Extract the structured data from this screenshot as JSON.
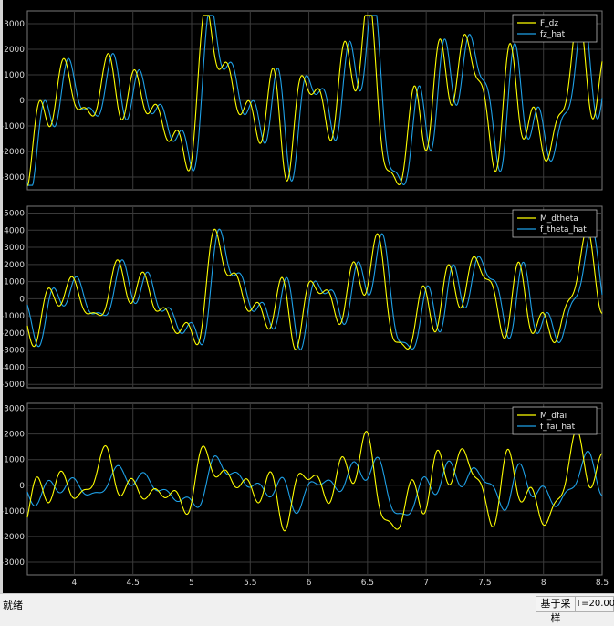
{
  "status": {
    "text": "就绪",
    "mode": "基于采样",
    "time": "T=20.000"
  },
  "colors": {
    "background": "#000000",
    "grid": "#3a3a3a",
    "tick_text": "#d8d8d8",
    "yellow": "#ffff00",
    "blue": "#1ea0e6"
  },
  "chart_data": [
    {
      "type": "line",
      "xlim": [
        3.6,
        8.5
      ],
      "ylim": [
        -3500,
        3500
      ],
      "yticks": [
        -3000,
        -2000,
        -1000,
        0,
        1000,
        2000,
        3000
      ],
      "ytick_labels": [
        "-3000",
        "-2000",
        "-1000",
        "0",
        "1000",
        "2000",
        "3000"
      ],
      "grid": true,
      "legend": "top-right",
      "series": [
        {
          "name": "F_dz",
          "color": "yellow",
          "shape": [
            [
              0.62,
              2800,
              0.5
            ],
            [
              1.05,
              1400,
              1.7
            ]
          ],
          "delay": 0
        },
        {
          "name": "fz_hat",
          "color": "blue",
          "shape": [
            [
              0.62,
              2800,
              0.5
            ],
            [
              1.05,
              1400,
              1.7
            ]
          ],
          "delay": 0.04
        }
      ]
    },
    {
      "type": "line",
      "xlim": [
        3.6,
        8.5
      ],
      "ylim": [
        -5200,
        5400
      ],
      "yticks": [
        -5000,
        -4000,
        -3000,
        -2000,
        -1000,
        0,
        1000,
        2000,
        3000,
        4000,
        5000
      ],
      "ytick_labels": [
        "-5000",
        "-4000",
        "-3000",
        "-2000",
        "-1000",
        "0",
        "1000",
        "2000",
        "3000",
        "4000",
        "5000"
      ],
      "grid": true,
      "legend": "top-right",
      "series": [
        {
          "name": "M_dtheta",
          "color": "yellow",
          "shape": [
            [
              0.55,
              2700,
              0.9
            ],
            [
              0.95,
              1700,
              0.2
            ]
          ],
          "delay": 0
        },
        {
          "name": "f_theta_hat",
          "color": "blue",
          "shape": [
            [
              0.55,
              2700,
              0.9
            ],
            [
              0.95,
              1700,
              0.2
            ]
          ],
          "delay": 0.04
        }
      ]
    },
    {
      "type": "line",
      "xlim": [
        3.6,
        8.5
      ],
      "ylim": [
        -3500,
        3200
      ],
      "yticks": [
        -3000,
        -2000,
        -1000,
        0,
        1000,
        2000,
        3000
      ],
      "ytick_labels": [
        "-3000",
        "-2000",
        "-1000",
        "0",
        "1000",
        "2000",
        "3000"
      ],
      "xticks": [
        4,
        4.5,
        5,
        5.5,
        6,
        6.5,
        7,
        7.5,
        8,
        8.5
      ],
      "xtick_labels": [
        "4",
        "4.5",
        "5",
        "5.5",
        "6",
        "6.5",
        "7",
        "7.5",
        "8",
        "8.5"
      ],
      "grid": true,
      "legend": "top-right",
      "series": [
        {
          "name": "M_dfai",
          "color": "yellow",
          "shape": [
            [
              0.62,
              1500,
              0.3
            ],
            [
              1.15,
              1100,
              2.1
            ]
          ],
          "delay": 0
        },
        {
          "name": "f_fai_hat",
          "color": "blue",
          "shape": [
            [
              0.45,
              900,
              1.2
            ],
            [
              0.8,
              700,
              0.5
            ]
          ],
          "delay": 0.02
        }
      ]
    }
  ]
}
